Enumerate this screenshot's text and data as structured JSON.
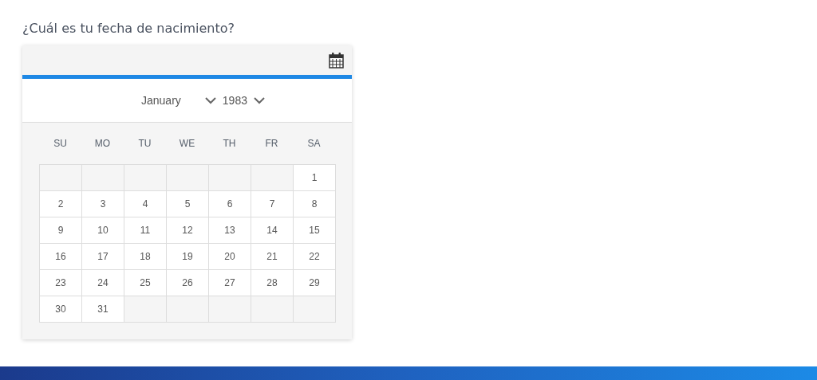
{
  "question": "¿Cuál es tu fecha de nacimiento?",
  "calendar": {
    "month": "January",
    "year": "1983",
    "weekdays": [
      "SU",
      "MO",
      "TU",
      "WE",
      "TH",
      "FR",
      "SA"
    ],
    "weeks": [
      [
        {
          "kind": "blank"
        },
        {
          "kind": "blank"
        },
        {
          "kind": "blank"
        },
        {
          "kind": "blank"
        },
        {
          "kind": "blank"
        },
        {
          "kind": "blank"
        },
        {
          "kind": "day",
          "day": "1"
        }
      ],
      [
        {
          "kind": "day",
          "day": "2"
        },
        {
          "kind": "day",
          "day": "3"
        },
        {
          "kind": "day",
          "day": "4"
        },
        {
          "kind": "day",
          "day": "5"
        },
        {
          "kind": "day",
          "day": "6"
        },
        {
          "kind": "day",
          "day": "7"
        },
        {
          "kind": "day",
          "day": "8"
        }
      ],
      [
        {
          "kind": "day",
          "day": "9"
        },
        {
          "kind": "day",
          "day": "10"
        },
        {
          "kind": "day",
          "day": "11"
        },
        {
          "kind": "day",
          "day": "12"
        },
        {
          "kind": "day",
          "day": "13"
        },
        {
          "kind": "day",
          "day": "14"
        },
        {
          "kind": "day",
          "day": "15"
        }
      ],
      [
        {
          "kind": "day",
          "day": "16"
        },
        {
          "kind": "day",
          "day": "17"
        },
        {
          "kind": "day",
          "day": "18"
        },
        {
          "kind": "day",
          "day": "19"
        },
        {
          "kind": "day",
          "day": "20"
        },
        {
          "kind": "day",
          "day": "21"
        },
        {
          "kind": "day",
          "day": "22"
        }
      ],
      [
        {
          "kind": "day",
          "day": "23"
        },
        {
          "kind": "day",
          "day": "24"
        },
        {
          "kind": "day",
          "day": "25"
        },
        {
          "kind": "day",
          "day": "26"
        },
        {
          "kind": "day",
          "day": "27"
        },
        {
          "kind": "day",
          "day": "28"
        },
        {
          "kind": "day",
          "day": "29"
        }
      ],
      [
        {
          "kind": "day",
          "day": "30"
        },
        {
          "kind": "day",
          "day": "31"
        },
        {
          "kind": "blank"
        },
        {
          "kind": "blank"
        },
        {
          "kind": "blank"
        },
        {
          "kind": "blank"
        },
        {
          "kind": "blank"
        }
      ]
    ]
  }
}
